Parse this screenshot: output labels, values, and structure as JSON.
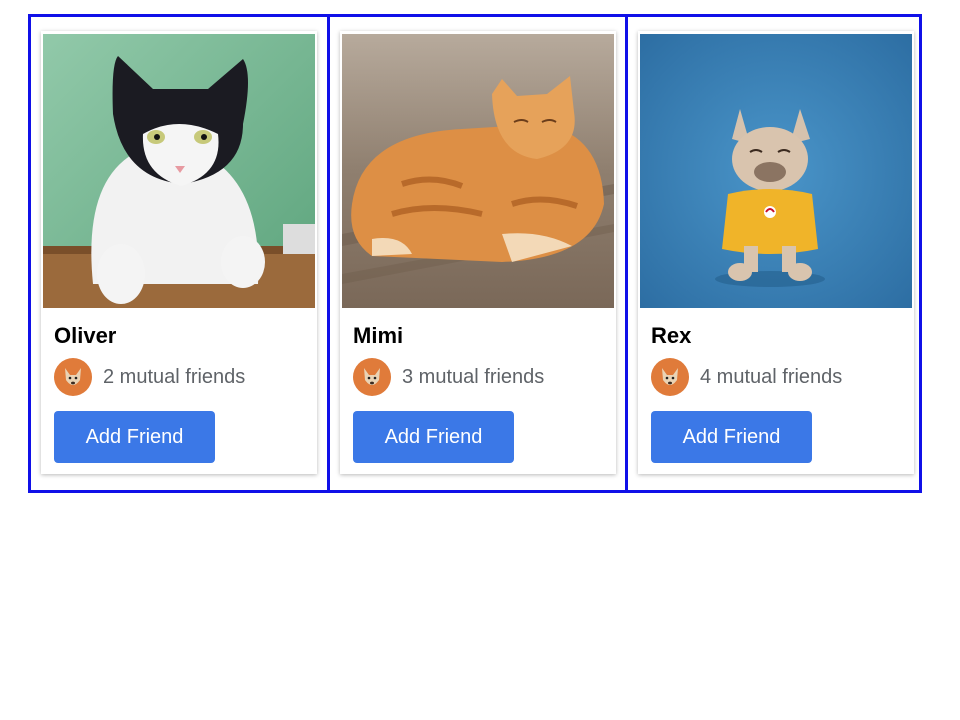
{
  "cards": [
    {
      "name": "Oliver",
      "mutual": "2 mutual friends",
      "button": "Add Friend",
      "photo": "cat-photo-icon"
    },
    {
      "name": "Mimi",
      "mutual": "3 mutual friends",
      "button": "Add Friend",
      "photo": "cat-photo-icon"
    },
    {
      "name": "Rex",
      "mutual": "4 mutual friends",
      "button": "Add Friend",
      "photo": "dog-photo-icon"
    }
  ],
  "colors": {
    "outline": "#1010e8",
    "button": "#3b78e7",
    "button_text": "#ffffff",
    "muted_text": "#5f6368"
  }
}
